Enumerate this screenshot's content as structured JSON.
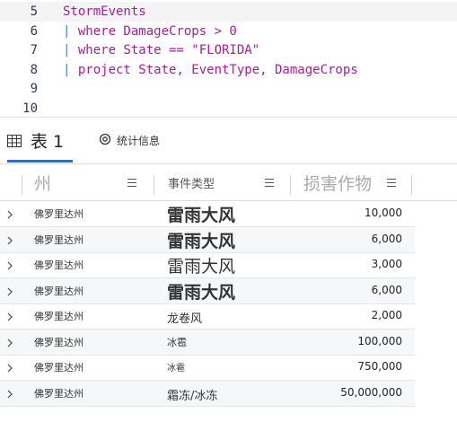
{
  "editor": {
    "lines": [
      {
        "num": "5",
        "parts": [
          {
            "t": "StormEvents",
            "c": "tok"
          }
        ]
      },
      {
        "num": "6",
        "parts": [
          {
            "t": "| ",
            "c": "pipe"
          },
          {
            "t": "where DamageCrops > 0",
            "c": "kw"
          }
        ]
      },
      {
        "num": "7",
        "parts": [
          {
            "t": "| ",
            "c": "pipe"
          },
          {
            "t": "where State == \"FLORIDA\"",
            "c": "kw"
          }
        ]
      },
      {
        "num": "8",
        "parts": [
          {
            "t": "| ",
            "c": "pipe"
          },
          {
            "t": "project State, EventType, DamageCrops",
            "c": "kw"
          }
        ]
      },
      {
        "num": "9",
        "parts": []
      },
      {
        "num": "10",
        "parts": []
      }
    ]
  },
  "tabs": {
    "table_label": "表 1",
    "stats_label": "统计信息"
  },
  "grid": {
    "columns": [
      "州",
      "事件类型",
      "损害作物"
    ],
    "rows": [
      {
        "state": "佛罗里达州",
        "event_type": "雷雨大风",
        "damage": "10,000",
        "size": 19
      },
      {
        "state": "佛罗里达州",
        "event_type": "雷雨大风",
        "damage": "6,000",
        "size": 19
      },
      {
        "state": "佛罗里达州",
        "event_type": "雷雨大风",
        "damage": "3,000",
        "size": 19
      },
      {
        "state": "佛罗里达州",
        "event_type": "雷雨大风",
        "damage": "6,000",
        "size": 19
      },
      {
        "state": "佛罗里达州",
        "event_type": "龙卷风",
        "damage": "2,000",
        "size": 13
      },
      {
        "state": "佛罗里达州",
        "event_type": "冰雹",
        "damage": "100,000",
        "size": 11
      },
      {
        "state": "佛罗里达州",
        "event_type": "冰雹",
        "damage": "750,000",
        "size": 10
      },
      {
        "state": "佛罗里达州",
        "event_type": "霜冻/冰冻",
        "damage": "50,000,000",
        "size": 13
      }
    ]
  },
  "colors": {
    "accent": "#2f6fb8",
    "keyword": "#a31e9a",
    "pipe": "#4a7cd6"
  }
}
